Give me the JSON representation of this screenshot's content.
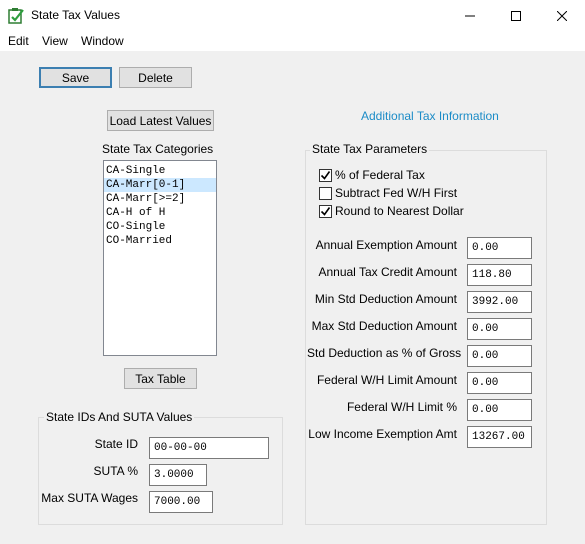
{
  "window": {
    "title": "State Tax Values"
  },
  "menu": {
    "items": [
      "Edit",
      "View",
      "Window"
    ]
  },
  "toolbar": {
    "save_label": "Save",
    "delete_label": "Delete"
  },
  "load_button": "Load Latest Values",
  "additional_link": "Additional Tax Information",
  "categories": {
    "title": "State Tax Categories",
    "items": [
      "CA-Single",
      "CA-Marr[0-1]",
      "CA-Marr[>=2]",
      "CA-H of H",
      "CO-Single",
      "CO-Married"
    ],
    "selected_index": 1
  },
  "tax_table_button": "Tax Table",
  "ids_group": {
    "title": "State IDs And SUTA Values",
    "state_id_label": "State ID",
    "state_id_value": "00-00-00",
    "suta_label": "SUTA %",
    "suta_value": "3.0000",
    "max_suta_label": "Max SUTA Wages",
    "max_suta_value": "7000.00"
  },
  "params": {
    "title": "State Tax Parameters",
    "checkboxes": [
      {
        "label": "% of Federal Tax",
        "checked": true
      },
      {
        "label": "Subtract Fed W/H First",
        "checked": false
      },
      {
        "label": "Round to Nearest Dollar",
        "checked": true
      }
    ],
    "fields": [
      {
        "label": "Annual Exemption Amount",
        "value": "0.00"
      },
      {
        "label": "Annual Tax Credit Amount",
        "value": "118.80"
      },
      {
        "label": "Min Std Deduction Amount",
        "value": "3992.00"
      },
      {
        "label": "Max Std Deduction Amount",
        "value": "0.00"
      },
      {
        "label": "Std Deduction as % of Gross",
        "value": "0.00"
      },
      {
        "label": "Federal W/H Limit Amount",
        "value": "0.00"
      },
      {
        "label": "Federal W/H Limit %",
        "value": "0.00"
      },
      {
        "label": "Low Income Exemption Amt",
        "value": "13267.00"
      }
    ]
  }
}
